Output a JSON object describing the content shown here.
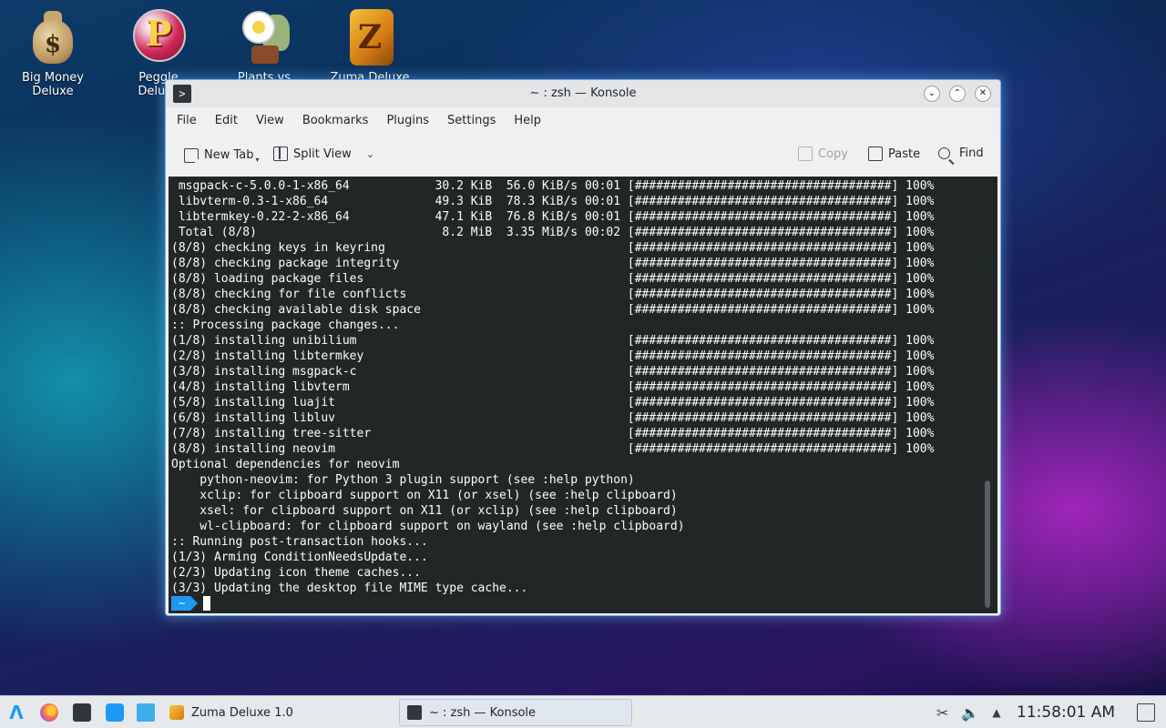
{
  "desktop": {
    "icons": [
      {
        "label": "Big Money\nDeluxe",
        "icon": "money-bag-icon"
      },
      {
        "label": "Peggle Deluxe",
        "icon": "peggle-icon"
      },
      {
        "label": "Plants vs",
        "icon": "plants-vs-zombies-icon"
      },
      {
        "label": "Zuma Deluxe",
        "icon": "zuma-icon"
      }
    ]
  },
  "window": {
    "title": "~ : zsh — Konsole",
    "menu": [
      "File",
      "Edit",
      "View",
      "Bookmarks",
      "Plugins",
      "Settings",
      "Help"
    ],
    "toolbar": {
      "new_tab": "New Tab",
      "split_view": "Split View",
      "copy": "Copy",
      "paste": "Paste",
      "find": "Find"
    },
    "terminal_lines": [
      " msgpack-c-5.0.0-1-x86_64            30.2 KiB  56.0 KiB/s 00:01 [####################################] 100%",
      " libvterm-0.3-1-x86_64               49.3 KiB  78.3 KiB/s 00:01 [####################################] 100%",
      " libtermkey-0.22-2-x86_64            47.1 KiB  76.8 KiB/s 00:01 [####################################] 100%",
      " Total (8/8)                          8.2 MiB  3.35 MiB/s 00:02 [####################################] 100%",
      "(8/8) checking keys in keyring                                  [####################################] 100%",
      "(8/8) checking package integrity                                [####################################] 100%",
      "(8/8) loading package files                                     [####################################] 100%",
      "(8/8) checking for file conflicts                               [####################################] 100%",
      "(8/8) checking available disk space                             [####################################] 100%",
      ":: Processing package changes...",
      "(1/8) installing unibilium                                      [####################################] 100%",
      "(2/8) installing libtermkey                                     [####################################] 100%",
      "(3/8) installing msgpack-c                                      [####################################] 100%",
      "(4/8) installing libvterm                                       [####################################] 100%",
      "(5/8) installing luajit                                         [####################################] 100%",
      "(6/8) installing libluv                                         [####################################] 100%",
      "(7/8) installing tree-sitter                                    [####################################] 100%",
      "(8/8) installing neovim                                         [####################################] 100%",
      "Optional dependencies for neovim",
      "    python-neovim: for Python 3 plugin support (see :help python)",
      "    xclip: for clipboard support on X11 (or xsel) (see :help clipboard)",
      "    xsel: for clipboard support on X11 (or xclip) (see :help clipboard)",
      "    wl-clipboard: for clipboard support on wayland (see :help clipboard)",
      ":: Running post-transaction hooks...",
      "(1/3) Arming ConditionNeedsUpdate...",
      "(2/3) Updating icon theme caches...",
      "(3/3) Updating the desktop file MIME type cache..."
    ],
    "prompt": "~"
  },
  "taskbar": {
    "tasks": [
      {
        "label": "Zuma Deluxe 1.0",
        "icon": "zuma-icon"
      },
      {
        "label": "~ : zsh — Konsole",
        "icon": "terminal-icon"
      }
    ],
    "clock": "11:58:01 AM"
  },
  "colors": {
    "accent": "#1d99f3",
    "terminal_bg": "#232627",
    "terminal_fg": "#fcfcfc"
  }
}
